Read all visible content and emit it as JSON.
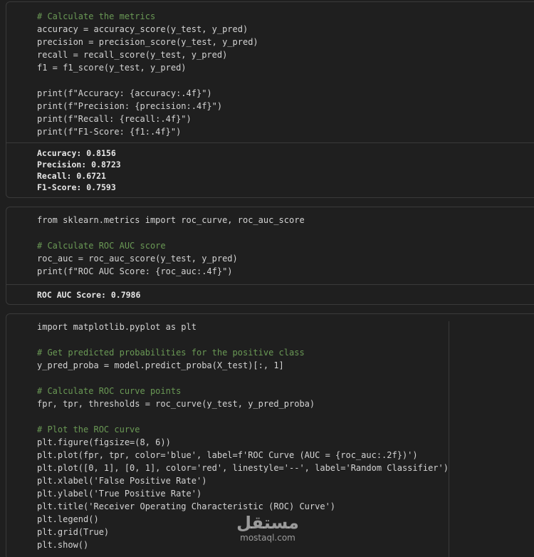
{
  "cell1": {
    "code": [
      "# Calculate the metrics",
      "accuracy = accuracy_score(y_test, y_pred)",
      "precision = precision_score(y_test, y_pred)",
      "recall = recall_score(y_test, y_pred)",
      "f1 = f1_score(y_test, y_pred)",
      "",
      "print(f\"Accuracy: {accuracy:.4f}\")",
      "print(f\"Precision: {precision:.4f}\")",
      "print(f\"Recall: {recall:.4f}\")",
      "print(f\"F1-Score: {f1:.4f}\")"
    ],
    "output": [
      "Accuracy: 0.8156",
      "Precision: 0.8723",
      "Recall: 0.6721",
      "F1-Score: 0.7593"
    ]
  },
  "cell2": {
    "code": [
      "from sklearn.metrics import roc_curve, roc_auc_score",
      "",
      "# Calculate ROC AUC score",
      "roc_auc = roc_auc_score(y_test, y_pred)",
      "print(f\"ROC AUC Score: {roc_auc:.4f}\")"
    ],
    "output": [
      "ROC AUC Score: 0.7986"
    ]
  },
  "cell3": {
    "code": [
      "import matplotlib.pyplot as plt",
      "",
      "# Get predicted probabilities for the positive class",
      "y_pred_proba = model.predict_proba(X_test)[:, 1]",
      "",
      "# Calculate ROC curve points",
      "fpr, tpr, thresholds = roc_curve(y_test, y_pred_proba)",
      "",
      "# Plot the ROC curve",
      "plt.figure(figsize=(8, 6))",
      "plt.plot(fpr, tpr, color='blue', label=f'ROC Curve (AUC = {roc_auc:.2f})')",
      "plt.plot([0, 1], [0, 1], color='red', linestyle='--', label='Random Classifier')",
      "plt.xlabel('False Positive Rate')",
      "plt.ylabel('True Positive Rate')",
      "plt.title('Receiver Operating Characteristic (ROC) Curve')",
      "plt.legend()",
      "plt.grid(True)",
      "plt.show()"
    ]
  },
  "watermark": {
    "logo_text": "مستقل",
    "url": "mostaql.com"
  }
}
